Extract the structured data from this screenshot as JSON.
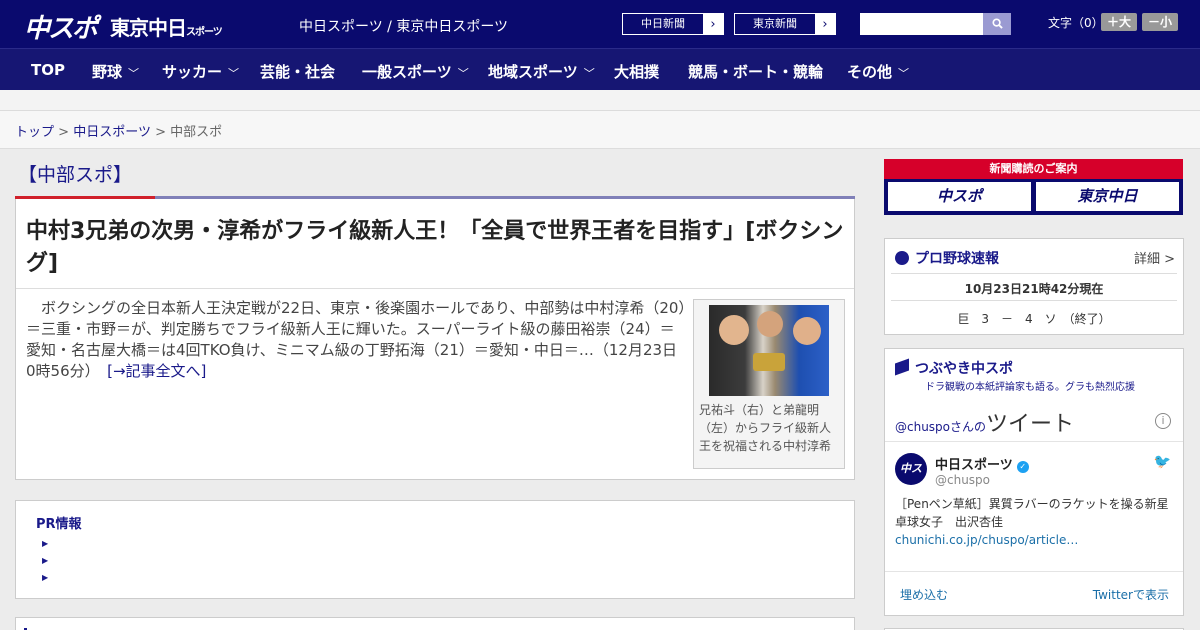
{
  "header": {
    "logo_main": "中スポ",
    "logo_tokyo": "東京中日",
    "logo_tokyo_small": "スポーツ",
    "site_name": "中日スポーツ / 東京中日スポーツ",
    "paper_links": [
      {
        "label": "中日新聞"
      },
      {
        "label": "東京新聞"
      }
    ],
    "search": {
      "placeholder": "",
      "button_icon": "search-icon"
    },
    "font_size": {
      "label": "文字（0）",
      "larger": "＋大",
      "smaller": "－小"
    }
  },
  "nav": {
    "items": [
      {
        "label": "TOP",
        "has_menu": false
      },
      {
        "label": "野球",
        "has_menu": true
      },
      {
        "label": "サッカー",
        "has_menu": true
      },
      {
        "label": "芸能・社会",
        "has_menu": false
      },
      {
        "label": "一般スポーツ",
        "has_menu": true
      },
      {
        "label": "地域スポーツ",
        "has_menu": true
      },
      {
        "label": "大相撲",
        "has_menu": false
      },
      {
        "label": "競馬・ボート・競輪",
        "has_menu": false
      },
      {
        "label": "その他",
        "has_menu": true
      }
    ]
  },
  "breadcrumb": {
    "items": [
      "トップ",
      "中日スポーツ",
      "中部スポ"
    ],
    "separator": ">"
  },
  "main": {
    "section_title": "【中部スポ】",
    "article": {
      "headline": "中村3兄弟の次男・淳希がフライ級新人王！「全員で世界王者を目指す」[ボクシング]",
      "body": "　ボクシングの全日本新人王決定戦が22日、東京・後楽園ホールであり、中部勢は中村淳希（20）＝三重・市野＝が、判定勝ちでフライ級新人王に輝いた。スーパーライト級の藤田裕崇（24）＝愛知・名古屋大橋＝は4回TKO負け、ミニマム級の丁野拓海（21）＝愛知・中日＝…（12月23日 0時56分）　",
      "more_link": "[→記事全文へ]",
      "photo_caption": "兄祐斗（右）と弟龍明（左）からフライ級新人王を祝福される中村淳希"
    },
    "pr": {
      "title": "PR情報",
      "items": [
        "",
        "",
        ""
      ]
    }
  },
  "sidebar": {
    "subscribe": {
      "title": "新聞購読のご案内",
      "logos": [
        "中スポ",
        "東京中日"
      ]
    },
    "baseball": {
      "title": "プロ野球速報",
      "detail": "詳細 >",
      "updated": "10月23日21時42分現在",
      "score": "巨　3　－　4　ソ　（終了）"
    },
    "tweets": {
      "title": "つぶやき中スポ",
      "subtitle": "ドラ観戦の本紙評論家も語る。グラも熱烈応援",
      "header_prefix": "@chuspoさんの",
      "header_main": "ツイート",
      "tweet": {
        "name": "中日スポーツ",
        "handle": "@chuspo",
        "text": "［Penペン草紙］異質ラバーのラケットを操る新星　卓球女子　出沢杏佳",
        "link": "chunichi.co.jp/chuspo/article…"
      },
      "embed_label": "埋め込む",
      "view_label": "Twitterで表示"
    }
  },
  "colors": {
    "header_bg": "#0a0a6e",
    "nav_bg": "#161673",
    "accent_red": "#d0202a",
    "link": "#1a1a8a"
  }
}
